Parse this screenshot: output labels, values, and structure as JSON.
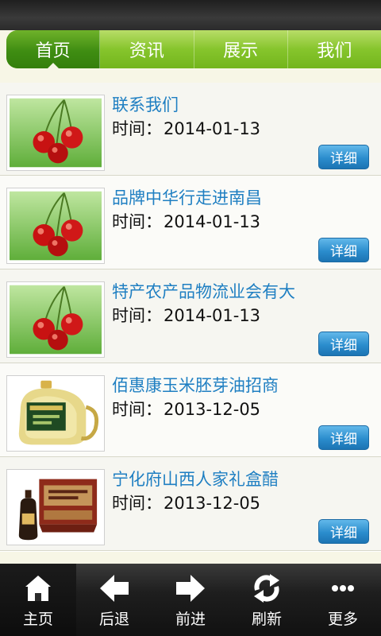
{
  "tabs": [
    {
      "label": "首页"
    },
    {
      "label": "资讯"
    },
    {
      "label": "展示"
    },
    {
      "label": "我们"
    }
  ],
  "list": {
    "date_label": "时间：",
    "detail_label": "详细",
    "items": [
      {
        "title": "联系我们",
        "date": "2014-01-13",
        "image": "cherries"
      },
      {
        "title": "品牌中华行走进南昌",
        "date": "2014-01-13",
        "image": "cherries"
      },
      {
        "title": "特产农产品物流业会有大",
        "date": "2014-01-13",
        "image": "cherries"
      },
      {
        "title": "佰惠康玉米胚芽油招商",
        "date": "2013-12-05",
        "image": "oil-bottle"
      },
      {
        "title": "宁化府山西人家礼盒醋",
        "date": "2013-12-05",
        "image": "vinegar-giftbox"
      }
    ]
  },
  "bottom_nav": [
    {
      "label": "主页",
      "icon": "home-icon"
    },
    {
      "label": "后退",
      "icon": "arrow-left-icon"
    },
    {
      "label": "前进",
      "icon": "arrow-right-icon"
    },
    {
      "label": "刷新",
      "icon": "refresh-icon"
    },
    {
      "label": "更多",
      "icon": "more-icon"
    }
  ],
  "colors": {
    "tab_green": "#86c52c",
    "tab_active": "#3f8d12",
    "title_blue": "#1f7fc2",
    "button_blue": "#2b8dcd"
  }
}
